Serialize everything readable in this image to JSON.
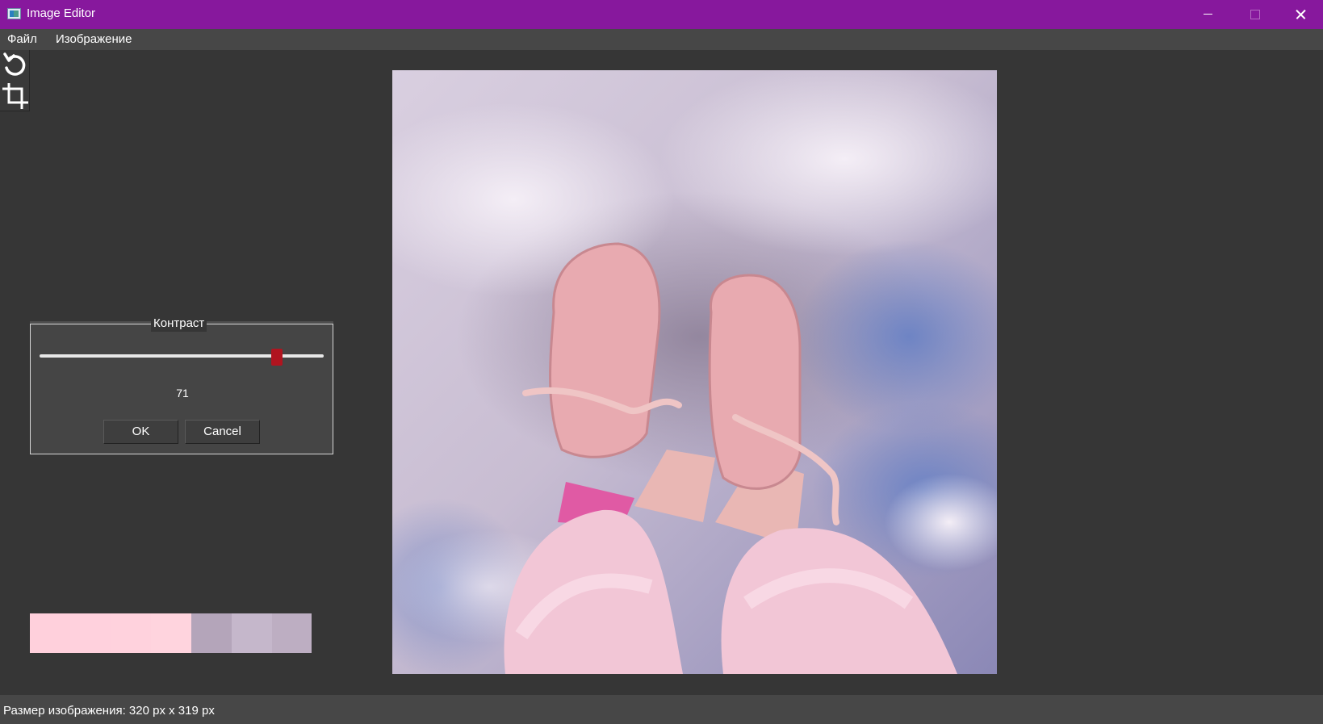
{
  "window": {
    "title": "Image Editor"
  },
  "menu": {
    "file_label": "Файл",
    "image_label": "Изображение"
  },
  "toolbar": {
    "tools": [
      {
        "icon": "rotate-icon"
      },
      {
        "icon": "crop-icon"
      }
    ]
  },
  "contrast_dialog": {
    "title": "Контраст",
    "value": "71",
    "slider_min": 0,
    "slider_max": 85,
    "slider_value": 71,
    "ok_label": "OK",
    "cancel_label": "Cancel",
    "accent_color": "#b0141f"
  },
  "palette": {
    "swatches": [
      "#ffd0dc",
      "#ffd1dd",
      "#ffd2dd",
      "#ffd4de",
      "#b4a5ba",
      "#c5b7cb",
      "#bdaec2"
    ]
  },
  "status": {
    "text": "Размер изображения: 320 px x 319 px"
  },
  "colors": {
    "titlebar": "#87189d",
    "background": "#363636",
    "menubar": "#474747"
  }
}
